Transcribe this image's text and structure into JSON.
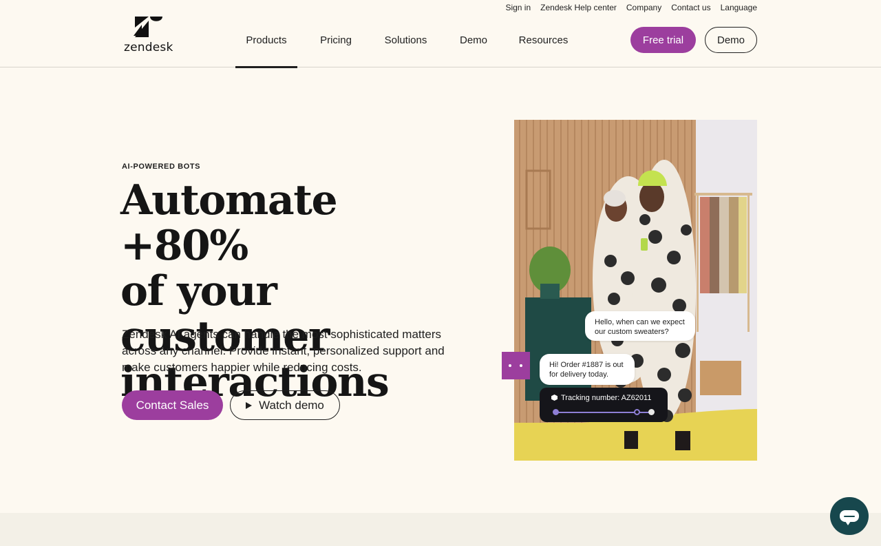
{
  "utility_nav": [
    "Sign in",
    "Zendesk Help center",
    "Company",
    "Contact us",
    "Language"
  ],
  "logo": {
    "wordmark": "zendesk"
  },
  "nav": {
    "items": [
      "Products",
      "Pricing",
      "Solutions",
      "Demo",
      "Resources"
    ],
    "active": "Products"
  },
  "header_buttons": {
    "free_trial": "Free trial",
    "demo": "Demo"
  },
  "hero": {
    "eyebrow": "AI-POWERED BOTS",
    "headline_lines": [
      "Automate +80%",
      "of your customer",
      "interactions"
    ],
    "subtext": "Zendesk AI agents can handle the most sophisticated matters across any channel. Provide instant, personalized support and make customers happier while reducing costs.",
    "cta_primary": "Contact Sales",
    "cta_secondary": "Watch demo"
  },
  "chat_overlay": {
    "customer_message": "Hello, when can we expect our custom sweaters?",
    "bot_reply": "Hi! Order #1887 is out for delivery today.",
    "tracking_label": "Tracking number: AZ62011",
    "tracking_progress": 0.85
  },
  "colors": {
    "brand_purple": "#9c3e9e",
    "background": "#fdf9f1",
    "chat_button": "#17474d"
  },
  "icons": [
    "zendesk-logo-icon",
    "play-icon",
    "package-icon",
    "chat-icon"
  ]
}
